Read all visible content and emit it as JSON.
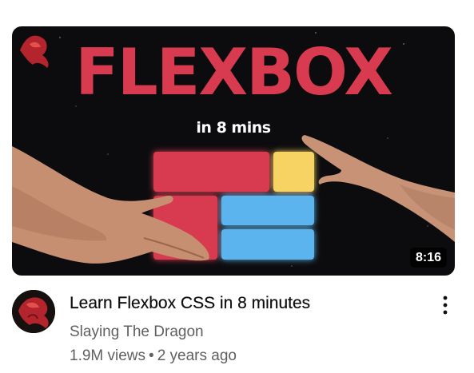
{
  "video": {
    "thumbnail": {
      "title_text": "FLEXBOX",
      "subtitle_text": "in 8 mins",
      "duration": "8:16",
      "colors": {
        "red": "#d83a4f",
        "yellow": "#f6d364",
        "blue": "#5bb4ee",
        "background": "#0c0c0e"
      }
    },
    "title": "Learn Flexbox CSS in 8 minutes",
    "channel": "Slaying The Dragon",
    "views": "1.9M views",
    "separator": "•",
    "age": "2 years ago",
    "more_icon": "more-vertical-icon"
  }
}
